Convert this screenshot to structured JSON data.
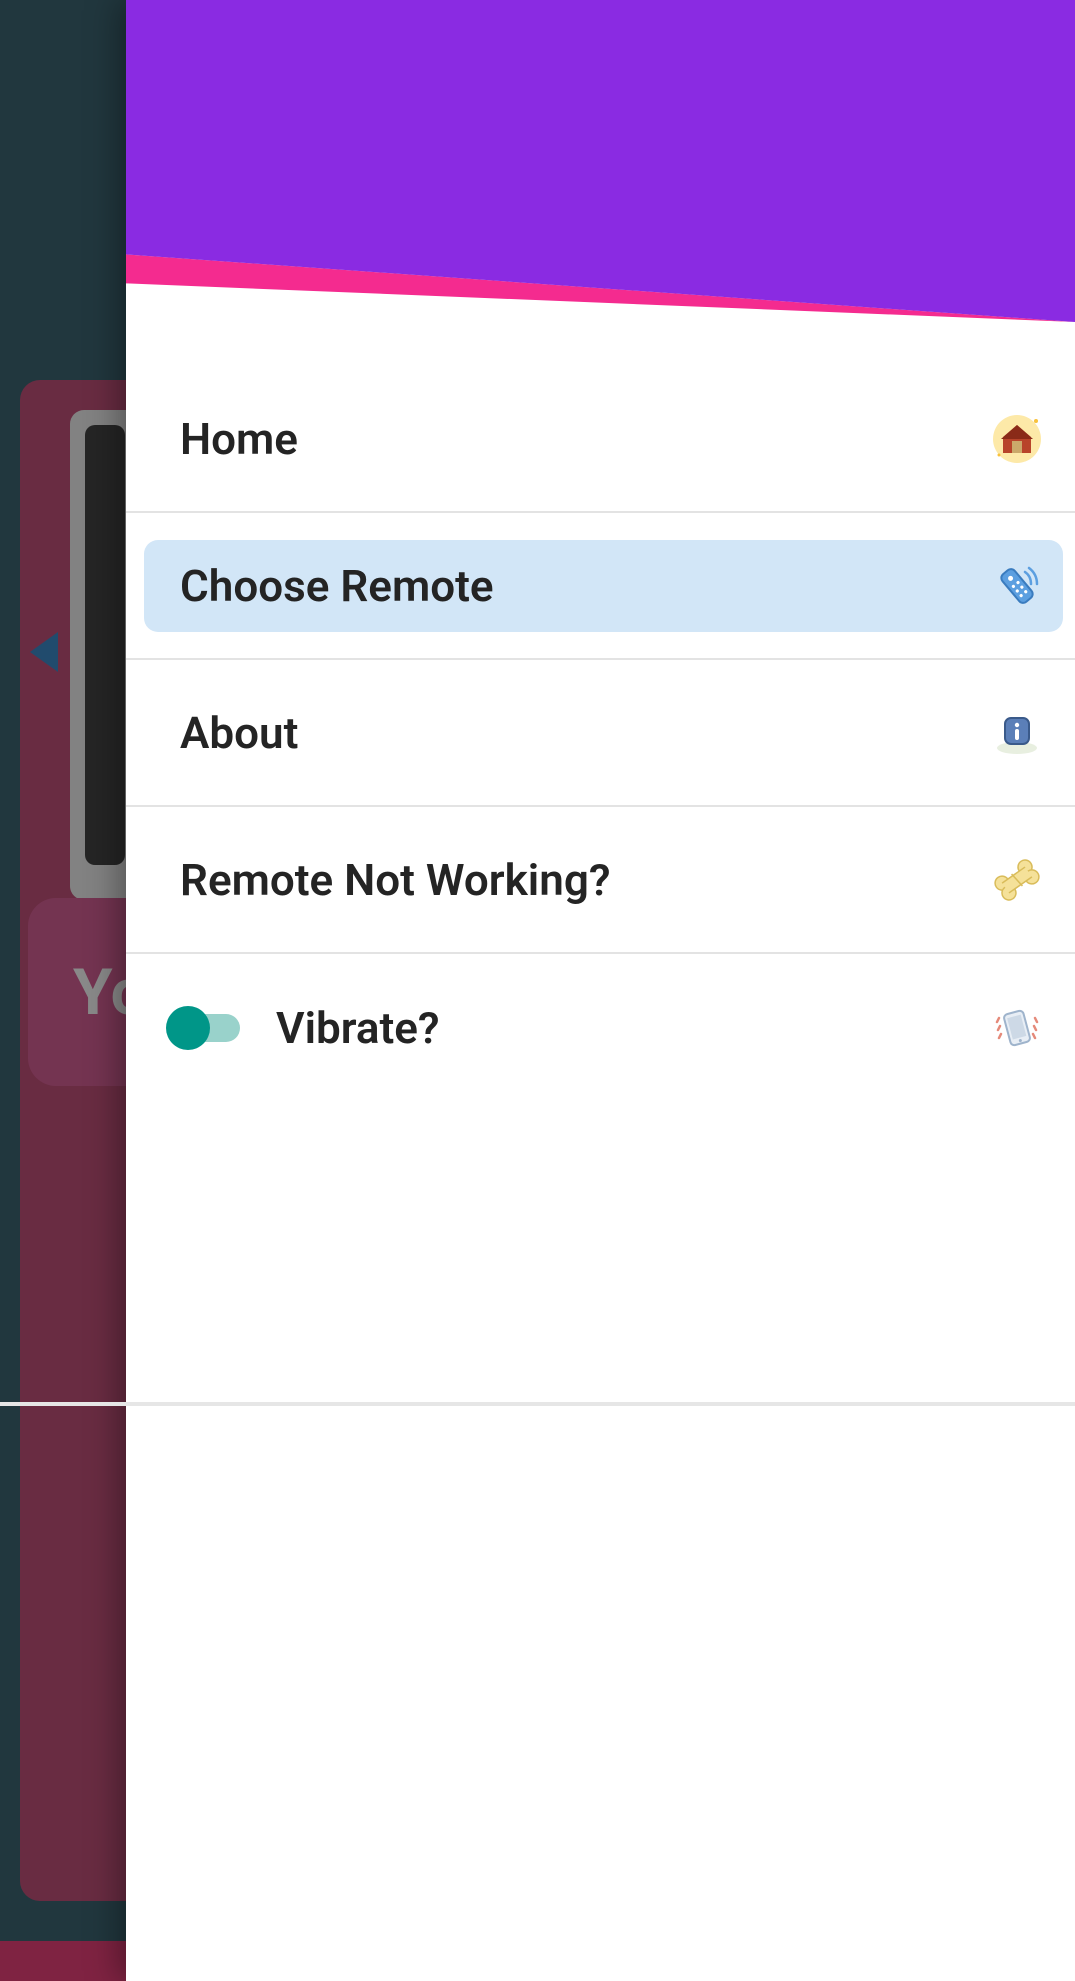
{
  "background": {
    "button_text": "Yo"
  },
  "drawer": {
    "header": {
      "accent_color": "#8a2be2",
      "stripe_color": "#f42b8f"
    },
    "items": [
      {
        "label": "Home",
        "icon": "home-icon",
        "selected": false
      },
      {
        "label": "Choose Remote",
        "icon": "remote-icon",
        "selected": true
      },
      {
        "label": "About",
        "icon": "info-icon",
        "selected": false
      },
      {
        "label": "Remote Not Working?",
        "icon": "bone-icon",
        "selected": false
      }
    ],
    "toggle": {
      "label": "Vibrate?",
      "icon": "vibrate-icon",
      "on": true
    }
  }
}
